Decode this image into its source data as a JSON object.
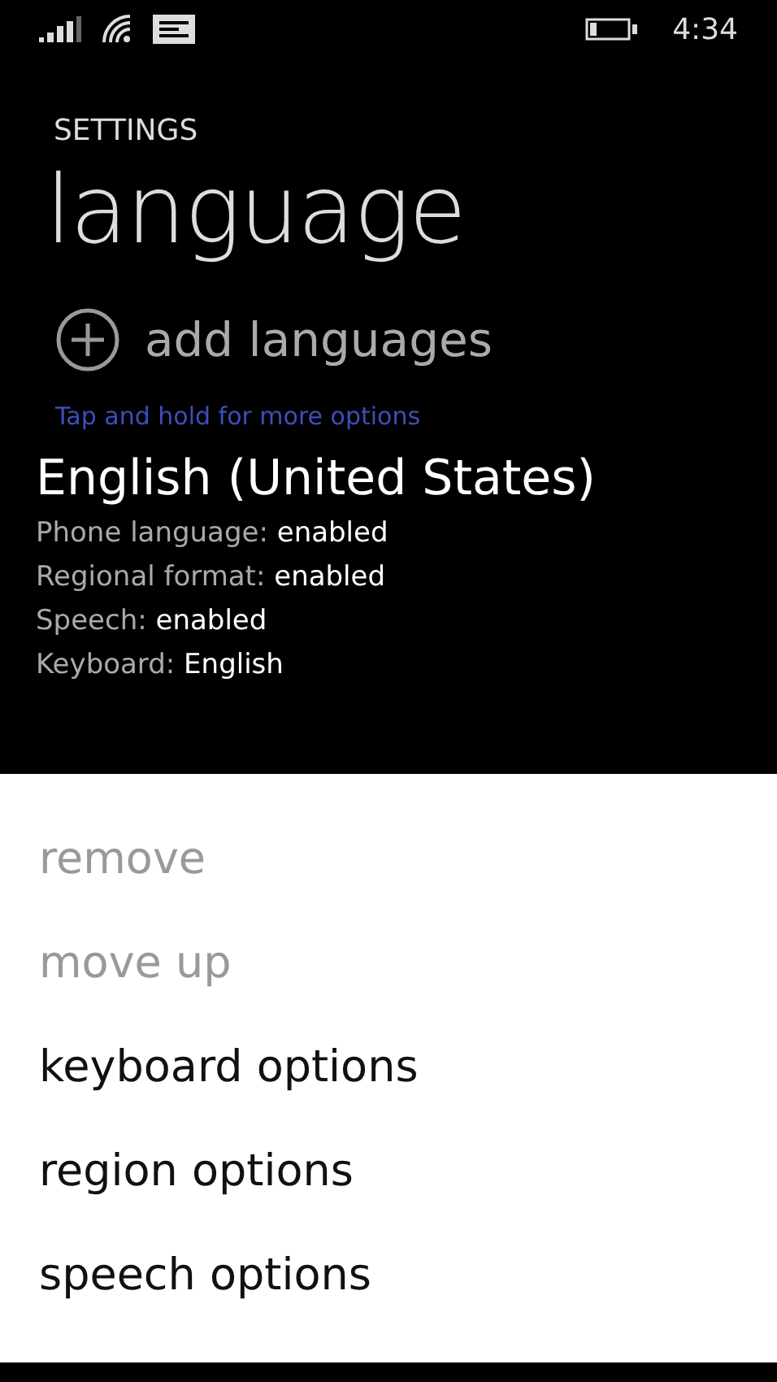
{
  "status_bar": {
    "time": "4:34"
  },
  "header": {
    "app": "SETTINGS",
    "title": "language"
  },
  "add_button": {
    "label": "add languages"
  },
  "hint": "Tap and hold for more options",
  "language": {
    "name": "English (United States)",
    "details": [
      {
        "label": "Phone language:",
        "value": "enabled"
      },
      {
        "label": "Regional format:",
        "value": "enabled"
      },
      {
        "label": "Speech:",
        "value": "enabled"
      },
      {
        "label": "Keyboard:",
        "value": "English"
      }
    ]
  },
  "context_menu": [
    {
      "label": "remove",
      "disabled": true
    },
    {
      "label": "move up",
      "disabled": true
    },
    {
      "label": "keyboard options",
      "disabled": false
    },
    {
      "label": "region options",
      "disabled": false
    },
    {
      "label": "speech options",
      "disabled": false
    }
  ]
}
